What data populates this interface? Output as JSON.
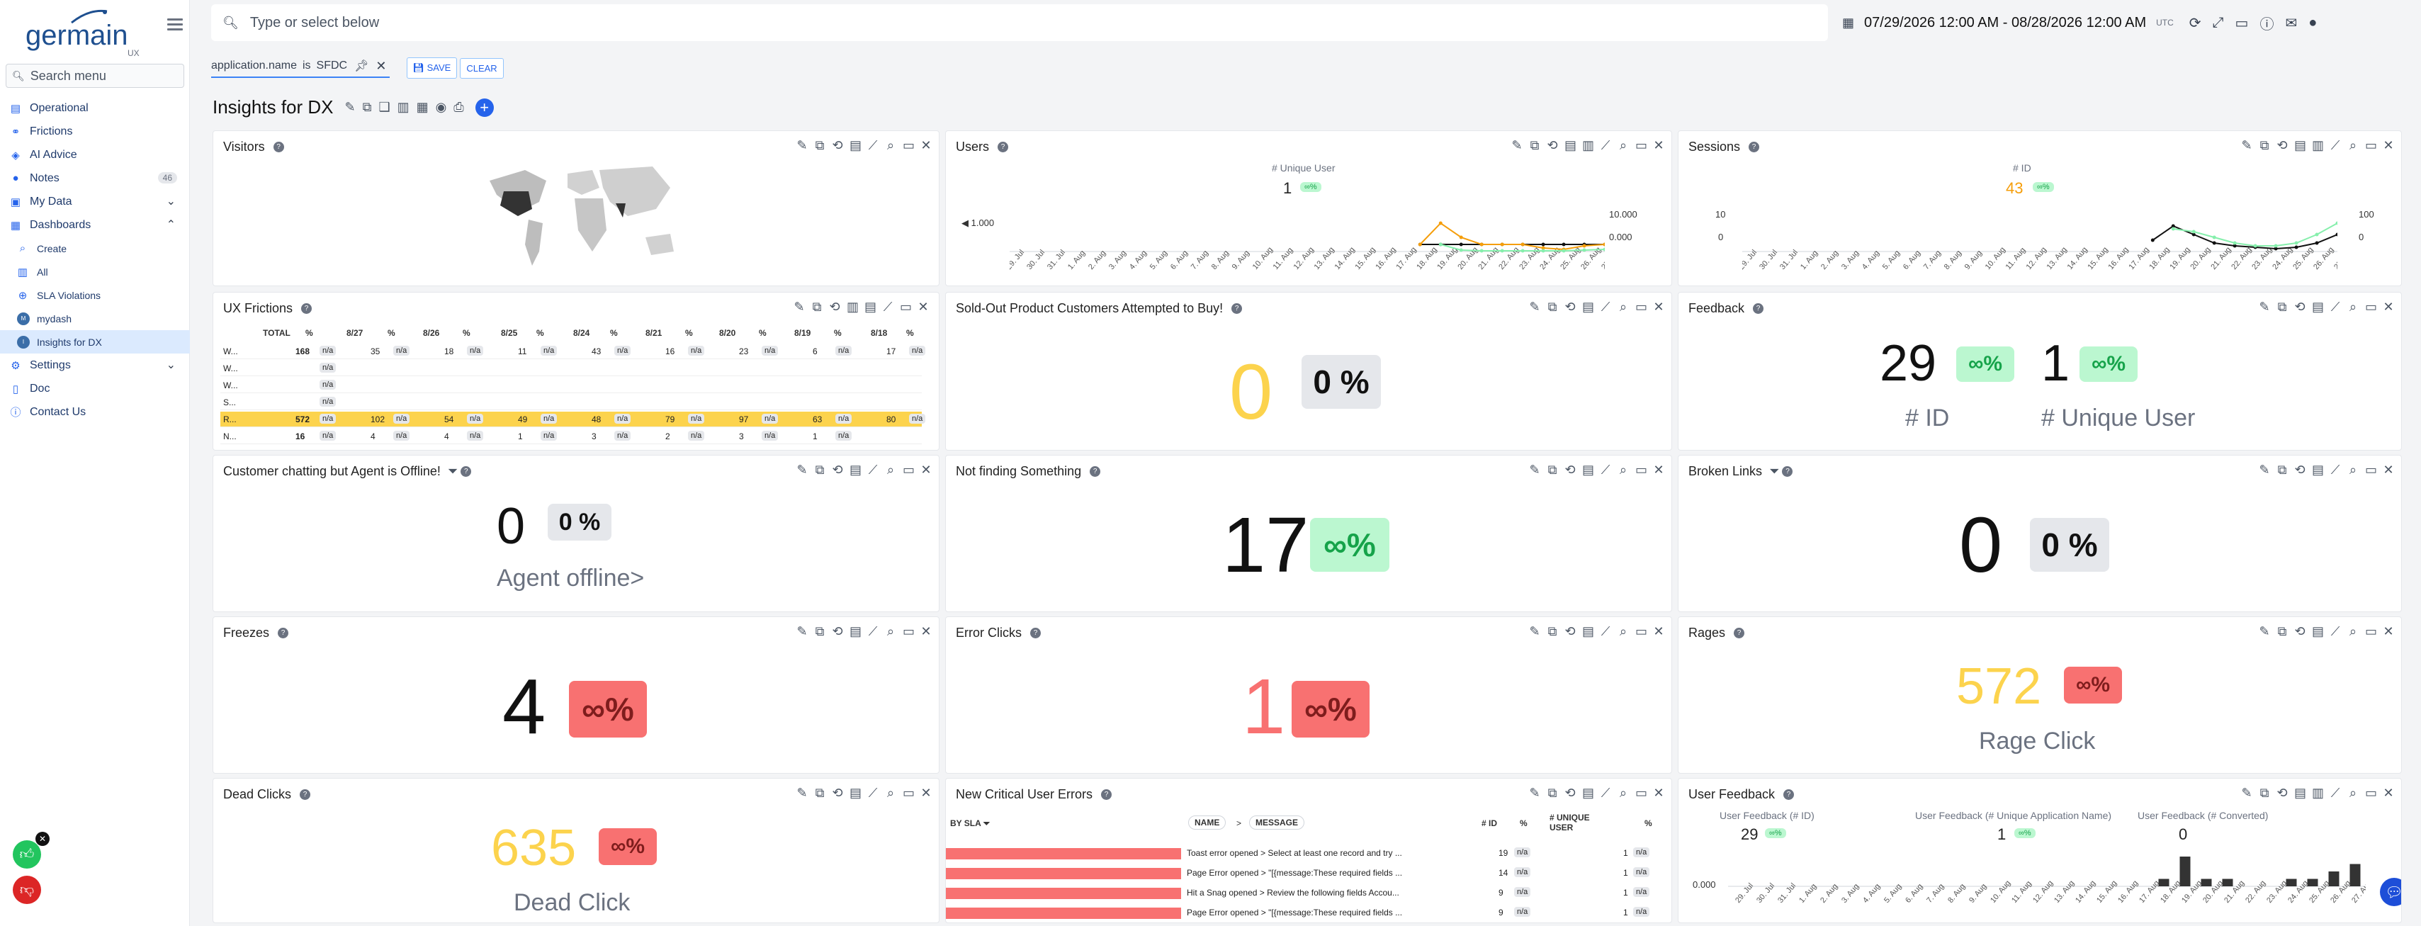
{
  "app": {
    "logo_text": "germain",
    "logo_sub": "UX",
    "search_menu_placeholder": "Search menu"
  },
  "nav": {
    "items": [
      {
        "label": "Operational",
        "icon": "chart-icon"
      },
      {
        "label": "Frictions",
        "icon": "friction-icon"
      },
      {
        "label": "AI Advice",
        "icon": "ai-icon"
      },
      {
        "label": "Notes",
        "icon": "notes-icon",
        "badge": "46"
      },
      {
        "label": "My Data",
        "icon": "folder-icon"
      },
      {
        "label": "Dashboards",
        "icon": "dashboard-icon"
      },
      {
        "label": "Create",
        "icon": "search-icon"
      },
      {
        "label": "All",
        "icon": "grid-icon"
      },
      {
        "label": "SLA Violations",
        "icon": "sla-icon"
      },
      {
        "label": "mydash",
        "icon": "avatar-icon"
      },
      {
        "label": "Insights for DX",
        "icon": "avatar-icon"
      },
      {
        "label": "Settings",
        "icon": "gear-icon"
      },
      {
        "label": "Doc",
        "icon": "doc-icon"
      },
      {
        "label": "Contact Us",
        "icon": "help-icon"
      }
    ]
  },
  "topbar": {
    "search_placeholder": "Type or select below",
    "date_range": "07/29/2026 12:00 AM - 08/28/2026 12:00 AM",
    "timezone": "UTC"
  },
  "filter": {
    "key": "application.name",
    "op": "is",
    "value": "SFDC",
    "save": "SAVE",
    "clear": "CLEAR"
  },
  "dashboard": {
    "title": "Insights for DX"
  },
  "widgets": {
    "visitors": {
      "title": "Visitors"
    },
    "users": {
      "title": "Users",
      "metric_label": "# Unique User",
      "value": "1",
      "pct": "∞%",
      "y_left": "1.000",
      "y_right_top": "10.000",
      "y_right_bottom": "0.000"
    },
    "sessions": {
      "title": "Sessions",
      "metric_label": "# ID",
      "value": "43",
      "pct": "∞%",
      "y_left_top": "10",
      "y_left_bottom": "0",
      "y_right_top": "100",
      "y_right_bottom": "0"
    },
    "ux_frictions": {
      "title": "UX Frictions",
      "headers": [
        "TOTAL",
        "%",
        "8/27",
        "%",
        "8/26",
        "%",
        "8/25",
        "%",
        "8/24",
        "%",
        "8/21",
        "%",
        "8/20",
        "%",
        "8/19",
        "%",
        "8/18",
        "%"
      ],
      "rows": [
        {
          "label": "W...",
          "total": "168",
          "vals": [
            "35",
            "18",
            "11",
            "43",
            "16",
            "23",
            "6",
            "17"
          ]
        },
        {
          "label": "W...",
          "total": "",
          "vals": []
        },
        {
          "label": "W...",
          "total": "",
          "vals": []
        },
        {
          "label": "S...",
          "total": "",
          "vals": []
        },
        {
          "label": "R...",
          "total": "572",
          "vals": [
            "102",
            "54",
            "49",
            "48",
            "79",
            "97",
            "63",
            "80"
          ]
        },
        {
          "label": "N...",
          "total": "16",
          "vals": [
            "4",
            "4",
            "1",
            "3",
            "2",
            "3",
            "1",
            ""
          ]
        }
      ],
      "na": "n/a"
    },
    "soldout": {
      "title": "Sold-Out Product Customers Attempted to Buy!",
      "value": "0",
      "pct": "0 %"
    },
    "feedback": {
      "title": "Feedback",
      "value1": "29",
      "pct1": "∞%",
      "label1": "# ID",
      "value2": "1",
      "pct2": "∞%",
      "label2": "# Unique User"
    },
    "agent_offline": {
      "title": "Customer chatting but Agent is Offline!",
      "value": "0",
      "pct": "0 %",
      "label": "Agent offline>"
    },
    "not_finding": {
      "title": "Not finding Something",
      "value": "17",
      "pct": "∞%"
    },
    "broken_links": {
      "title": "Broken Links",
      "value": "0",
      "pct": "0 %"
    },
    "freezes": {
      "title": "Freezes",
      "value": "4",
      "pct": "∞%"
    },
    "error_clicks": {
      "title": "Error Clicks",
      "value": "1",
      "pct": "∞%"
    },
    "rages": {
      "title": "Rages",
      "value": "572",
      "pct": "∞%",
      "label": "Rage Click"
    },
    "dead_clicks": {
      "title": "Dead Clicks",
      "value": "635",
      "pct": "∞%",
      "label": "Dead Click"
    },
    "critical_errors": {
      "title": "New Critical User Errors",
      "col_sla": "BY SLA",
      "col_name": "NAME",
      "col_message": "MESSAGE",
      "col_id": "# ID",
      "col_pct": "%",
      "col_unique": "# UNIQUE USER",
      "rows": [
        {
          "text": "Toast error opened > Select at least one record and try ...",
          "id": "19",
          "unique": "1"
        },
        {
          "text": "Page Error opened > \"[{message:These required fields ...",
          "id": "14",
          "unique": "1"
        },
        {
          "text": "Hit a Snag opened > Review the following fields Accou...",
          "id": "9",
          "unique": "1"
        },
        {
          "text": "Page Error opened > \"[{message:These required fields ...",
          "id": "9",
          "unique": "1"
        }
      ],
      "na": "n/a"
    },
    "user_feedback": {
      "title": "User Feedback",
      "m1_label": "User Feedback (# ID)",
      "m1_value": "29",
      "m1_pct": "∞%",
      "m2_label": "User Feedback (# Unique Application Name)",
      "m2_value": "1",
      "m2_pct": "∞%",
      "m3_label": "User Feedback (# Converted)",
      "m3_value": "0",
      "y_label": "0.000"
    }
  },
  "chart_data": [
    {
      "type": "line",
      "title": "Users",
      "x": [
        "29. Jul",
        "30. Jul",
        "31. Jul",
        "1. Aug",
        "2. Aug",
        "3. Aug",
        "4. Aug",
        "5. Aug",
        "6. Aug",
        "7. Aug",
        "8. Aug",
        "9. Aug",
        "10. Aug",
        "11. Aug",
        "12. Aug",
        "13. Aug",
        "14. Aug",
        "15. Aug",
        "16. Aug",
        "17. Aug",
        "18. Aug",
        "19. Aug",
        "20. Aug",
        "21. Aug",
        "22. Aug",
        "23. Aug",
        "24. Aug",
        "25. Aug",
        "26. Aug",
        "27. Aug"
      ],
      "series": [
        {
          "values": [
            null,
            null,
            null,
            null,
            null,
            null,
            null,
            null,
            null,
            null,
            null,
            null,
            null,
            null,
            null,
            null,
            null,
            null,
            null,
            null,
            1,
            1,
            1,
            1,
            1,
            1,
            1,
            1,
            1,
            1
          ]
        },
        {
          "values": [
            null,
            null,
            null,
            null,
            null,
            null,
            null,
            null,
            null,
            null,
            null,
            null,
            null,
            null,
            null,
            null,
            null,
            null,
            null,
            null,
            1,
            4,
            2,
            1,
            1,
            1,
            0.5,
            0.3,
            0.8,
            1
          ]
        },
        {
          "values": [
            null,
            null,
            null,
            null,
            null,
            null,
            null,
            null,
            null,
            null,
            null,
            null,
            null,
            null,
            null,
            null,
            null,
            null,
            null,
            null,
            null,
            1,
            0.2,
            0.1,
            0.1,
            0.1,
            0.1,
            0.1,
            0.2,
            0.3
          ]
        }
      ]
    },
    {
      "type": "line",
      "title": "Sessions",
      "x": [
        "29. Jul",
        "30. Jul",
        "31. Jul",
        "1. Aug",
        "2. Aug",
        "3. Aug",
        "4. Aug",
        "5. Aug",
        "6. Aug",
        "7. Aug",
        "8. Aug",
        "9. Aug",
        "10. Aug",
        "11. Aug",
        "12. Aug",
        "13. Aug",
        "14. Aug",
        "15. Aug",
        "16. Aug",
        "17. Aug",
        "18. Aug",
        "19. Aug",
        "20. Aug",
        "21. Aug",
        "22. Aug",
        "23. Aug",
        "24. Aug",
        "25. Aug",
        "26. Aug",
        "27. Aug"
      ],
      "series": [
        {
          "values": [
            null,
            null,
            null,
            null,
            null,
            null,
            null,
            null,
            null,
            null,
            null,
            null,
            null,
            null,
            null,
            null,
            null,
            null,
            null,
            null,
            4,
            9,
            6,
            3,
            2,
            1.5,
            1,
            1.5,
            3,
            6
          ]
        },
        {
          "values": [
            null,
            null,
            null,
            null,
            null,
            null,
            null,
            null,
            null,
            null,
            null,
            null,
            null,
            null,
            null,
            null,
            null,
            null,
            null,
            null,
            null,
            8,
            7,
            5,
            3,
            2,
            2,
            3,
            6,
            10
          ]
        }
      ]
    },
    {
      "type": "bar",
      "title": "User Feedback",
      "x": [
        "29. Jul",
        "30. Jul",
        "31. Jul",
        "1. Aug",
        "2. Aug",
        "3. Aug",
        "4. Aug",
        "5. Aug",
        "6. Aug",
        "7. Aug",
        "8. Aug",
        "9. Aug",
        "10. Aug",
        "11. Aug",
        "12. Aug",
        "13. Aug",
        "14. Aug",
        "15. Aug",
        "16. Aug",
        "17. Aug",
        "18. Aug",
        "19. Aug",
        "20. Aug",
        "21. Aug",
        "22. Aug",
        "23. Aug",
        "24. Aug",
        "25. Aug",
        "26. Aug",
        "27. Aug"
      ],
      "values": [
        0,
        0,
        0,
        0,
        0,
        0,
        0,
        0,
        0,
        0,
        0,
        0,
        0,
        0,
        0,
        0,
        0,
        0,
        0,
        0,
        1,
        4,
        1,
        1,
        0,
        0,
        1,
        1,
        2,
        3
      ]
    }
  ]
}
